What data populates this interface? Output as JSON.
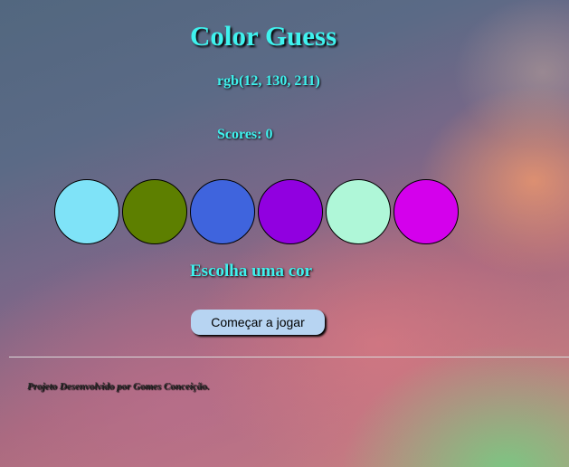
{
  "game": {
    "title": "Color Guess",
    "target_rgb": "rgb(12, 130, 211)",
    "scores_text": "Scores: 0",
    "message": "Escolha uma cor",
    "start_button_label": "Começar a jogar"
  },
  "options": [
    {
      "color": "#7fe3f8"
    },
    {
      "color": "#5d7f00"
    },
    {
      "color": "#3f64dd"
    },
    {
      "color": "#9100e0"
    },
    {
      "color": "#aff7d8"
    },
    {
      "color": "#d400ec"
    }
  ],
  "footer": {
    "credit": "Projeto Desenvolvido por Gomes Conceição."
  }
}
